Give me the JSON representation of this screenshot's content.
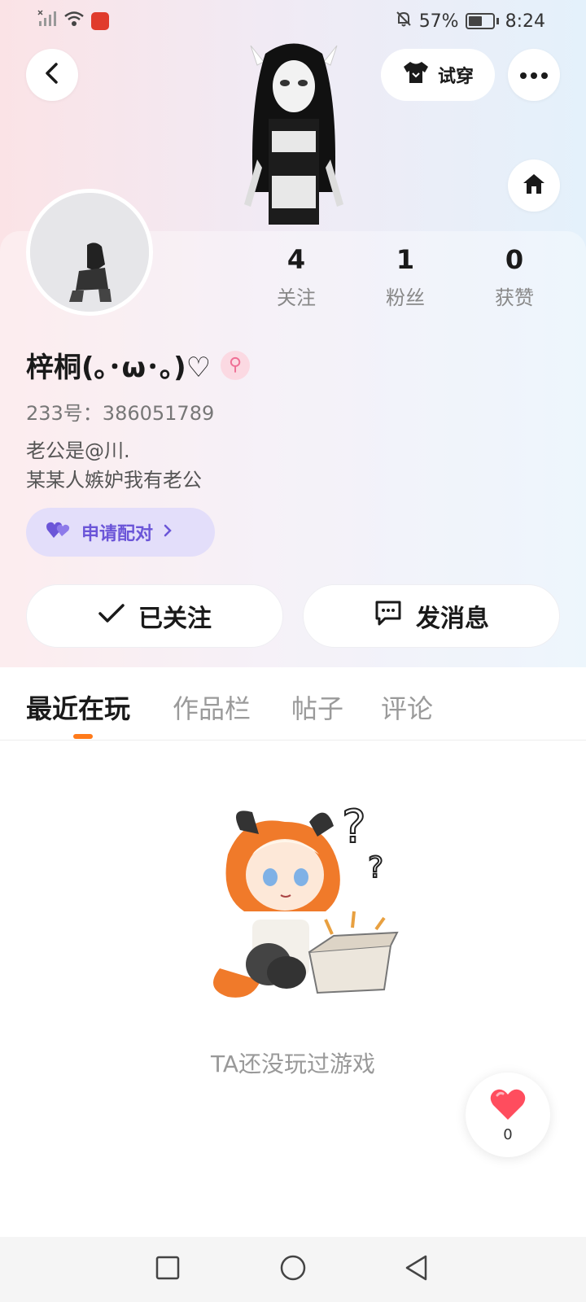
{
  "status_bar": {
    "battery_percent": "57%",
    "time": "8:24"
  },
  "header": {
    "try_on_label": "试穿"
  },
  "stats": [
    {
      "value": "4",
      "label": "关注"
    },
    {
      "value": "1",
      "label": "粉丝"
    },
    {
      "value": "0",
      "label": "获赞"
    }
  ],
  "profile": {
    "name": "梓桐(｡･ω･｡)♡",
    "uid": "233号：386051789",
    "bio_line1": "老公是@川.",
    "bio_line2": "某某人嫉妒我有老公",
    "pair_label": "申请配对",
    "gender_symbol": "⚲"
  },
  "actions": {
    "follow_label": "已关注",
    "message_label": "发消息"
  },
  "tabs": [
    {
      "label": "最近在玩",
      "active": true
    },
    {
      "label": "作品栏",
      "active": false
    },
    {
      "label": "帖子",
      "active": false
    },
    {
      "label": "评论",
      "active": false
    }
  ],
  "empty_state": {
    "text": "TA还没玩过游戏"
  },
  "like": {
    "count": "0"
  },
  "colors": {
    "accent_orange": "#ff7a1a",
    "pair_purple": "#6b55d8",
    "like_red": "#ff4d5e"
  }
}
